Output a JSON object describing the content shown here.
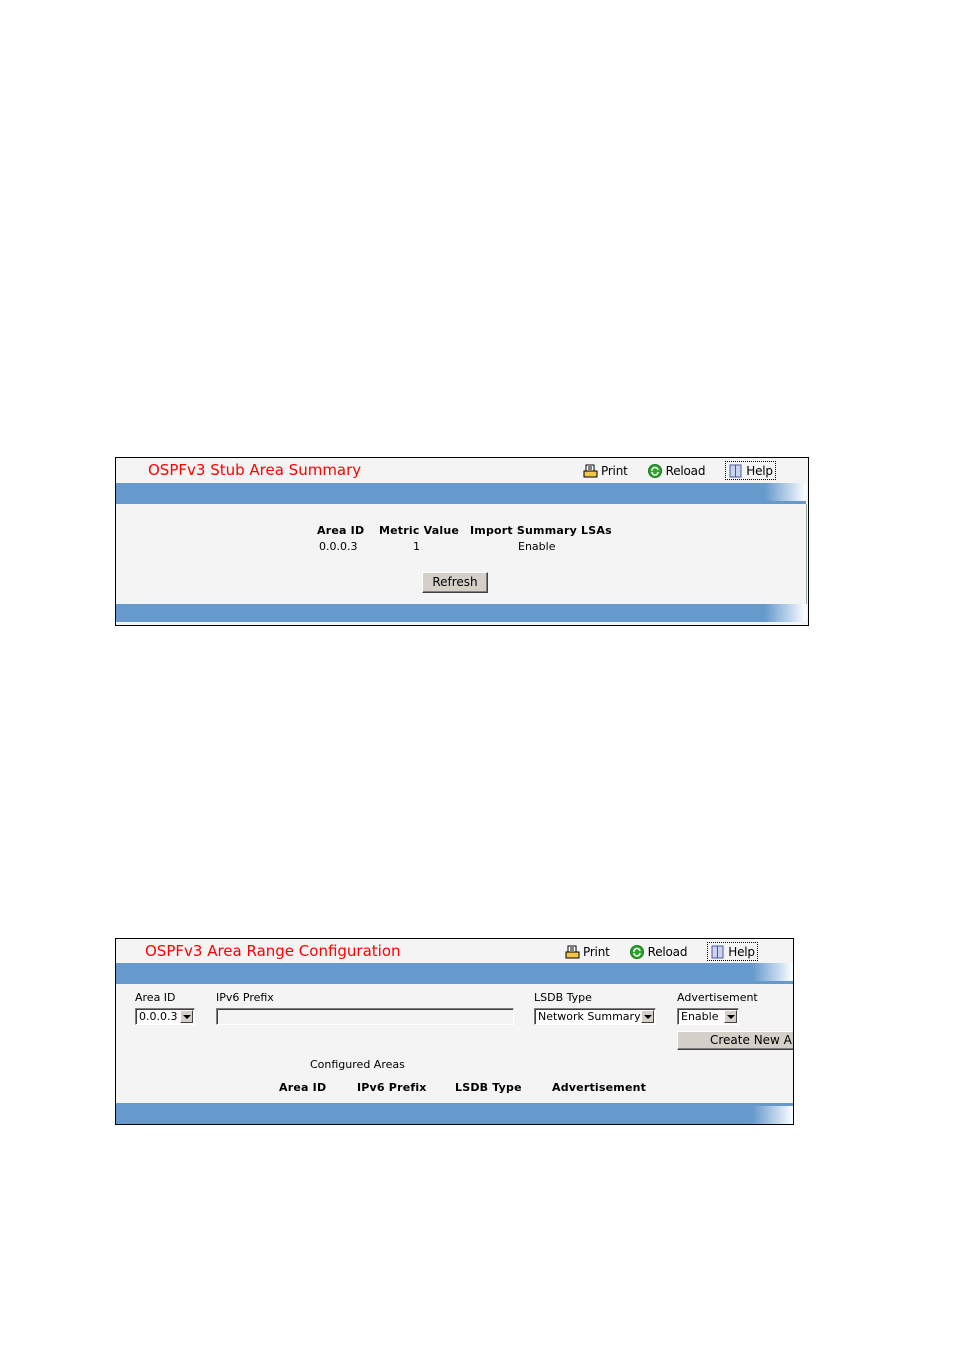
{
  "stub_area_summary": {
    "title": "OSPFv3 Stub Area Summary",
    "toolbar": {
      "print_label": "Print",
      "reload_label": "Reload",
      "help_label": "Help"
    },
    "table": {
      "columns": [
        "Area ID",
        "Metric Value",
        "Import Summary LSAs"
      ],
      "rows": [
        [
          "0.0.0.3",
          "1",
          "Enable"
        ]
      ]
    },
    "refresh_label": "Refresh"
  },
  "area_range_config": {
    "title": "OSPFv3 Area Range Configuration",
    "toolbar": {
      "print_label": "Print",
      "reload_label": "Reload",
      "help_label": "Help"
    },
    "form": {
      "area_id_label": "Area ID",
      "area_id_value": "0.0.0.3",
      "ipv6_prefix_label": "IPv6 Prefix",
      "ipv6_prefix_value": "",
      "lsdb_type_label": "LSDB Type",
      "lsdb_type_value": "Network Summary",
      "advertisement_label": "Advertisement",
      "advertisement_value": "Enable",
      "create_button_label": "Create New Area Range"
    },
    "configured_areas": {
      "caption": "Configured Areas",
      "columns": [
        "Area ID",
        "IPv6 Prefix",
        "LSDB Type",
        "Advertisement"
      ]
    }
  },
  "colors": {
    "title": "#ff0000",
    "bar": "#6699cc",
    "panel_bg": "#f4f4f4",
    "button_bg": "#d4d0c8"
  }
}
